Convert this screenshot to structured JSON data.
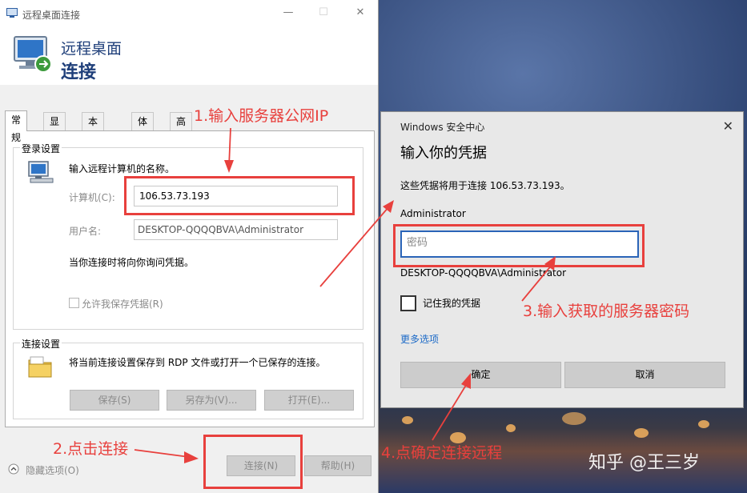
{
  "rdp_window": {
    "title": "远程桌面连接",
    "header_line1": "远程桌面",
    "header_line2": "连接",
    "tabs": [
      {
        "label": "常规"
      },
      {
        "label": "显示"
      },
      {
        "label": "本地资源"
      },
      {
        "label": "体验"
      },
      {
        "label": "高级"
      }
    ],
    "login_group": {
      "title": "登录设置",
      "prompt": "输入远程计算机的名称。",
      "computer_label": "计算机(C):",
      "computer_value": "106.53.73.193",
      "username_label": "用户名:",
      "username_value": "DESKTOP-QQQQBVA\\Administrator",
      "note": "当你连接时将向你询问凭据。",
      "save_credentials_label": "允许我保存凭据(R)"
    },
    "connection_group": {
      "title": "连接设置",
      "desc": "将当前连接设置保存到 RDP 文件或打开一个已保存的连接。",
      "save_label": "保存(S)",
      "save_as_label": "另存为(V)...",
      "open_label": "打开(E)..."
    },
    "hide_options_label": "隐藏选项(O)",
    "connect_label": "连接(N)",
    "help_label": "帮助(H)"
  },
  "security_dialog": {
    "app_name": "Windows 安全中心",
    "heading": "输入你的凭据",
    "description": "这些凭据将用于连接 106.53.73.193。",
    "username": "Administrator",
    "password_placeholder": "密码",
    "domain_user": "DESKTOP-QQQQBVA\\Administrator",
    "remember_label": "记住我的凭据",
    "more_options_label": "更多选项",
    "ok_label": "确定",
    "cancel_label": "取消"
  },
  "annotations": {
    "step1": "1.输入服务器公网IP",
    "step2": "2.点击连接",
    "step3": "3.输入获取的服务器密码",
    "step4": "4.点确定连接远程",
    "color": "#e8403d"
  },
  "watermark": "知乎 @王三岁"
}
